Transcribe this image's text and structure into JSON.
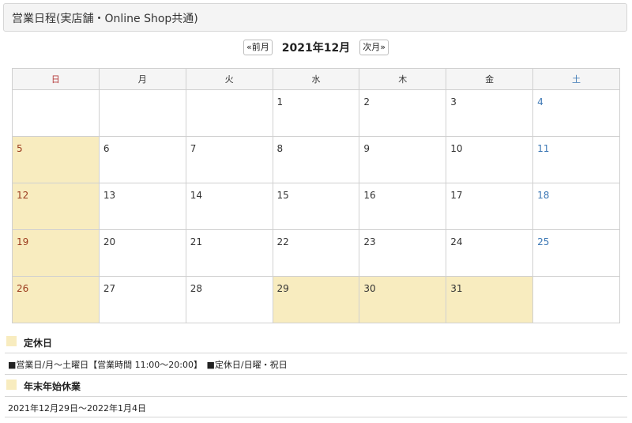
{
  "header": {
    "title": "営業日程(実店舗・Online Shop共通)"
  },
  "nav": {
    "prev_label": "«前月",
    "month_label": "2021年12月",
    "next_label": "次月»"
  },
  "weekdays": [
    "日",
    "月",
    "火",
    "水",
    "木",
    "金",
    "土"
  ],
  "weeks": [
    [
      "",
      "",
      "",
      "1",
      "2",
      "3",
      "4"
    ],
    [
      "5",
      "6",
      "7",
      "8",
      "9",
      "10",
      "11"
    ],
    [
      "12",
      "13",
      "14",
      "15",
      "16",
      "17",
      "18"
    ],
    [
      "19",
      "20",
      "21",
      "22",
      "23",
      "24",
      "25"
    ],
    [
      "26",
      "27",
      "28",
      "29",
      "30",
      "31",
      ""
    ]
  ],
  "highlighted_days": [
    "5",
    "12",
    "19",
    "26",
    "29",
    "30",
    "31"
  ],
  "legend": [
    {
      "label": "定休日",
      "detail": "■営業日/月～土曜日【営業時間 11:00～20:00】　■定休日/日曜・祝日"
    },
    {
      "label": "年末年始休業",
      "detail": "2021年12月29日～2022年1月4日"
    }
  ],
  "colors": {
    "highlight": "#f8ecbf",
    "sunday": "#9b3b1e",
    "saturday": "#3d78b5"
  }
}
